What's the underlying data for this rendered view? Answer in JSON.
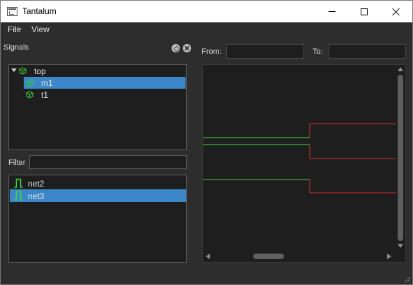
{
  "window": {
    "title": "Tantalum"
  },
  "menubar": {
    "items": [
      {
        "label": "File"
      },
      {
        "label": "View"
      }
    ]
  },
  "signals_dock": {
    "title": "Signals",
    "tree": [
      {
        "label": "top",
        "expanded": true,
        "selected": false,
        "icon": "module-icon"
      },
      {
        "label": "m1",
        "selected": true,
        "icon": "module-icon"
      },
      {
        "label": "t1",
        "selected": false,
        "icon": "module-icon"
      }
    ],
    "filter": {
      "label": "Filter",
      "value": ""
    },
    "signals": [
      {
        "label": "net2",
        "selected": false,
        "icon": "pulse-icon"
      },
      {
        "label": "net3",
        "selected": true,
        "icon": "pulse-icon"
      }
    ]
  },
  "range": {
    "from_label": "From:",
    "from_value": "",
    "to_label": "To:",
    "to_value": ""
  },
  "colors": {
    "low_trace": "#3ddc3d",
    "high_trace": "#e03030",
    "selection": "#3b87c9",
    "module_icon": "#38c238"
  }
}
